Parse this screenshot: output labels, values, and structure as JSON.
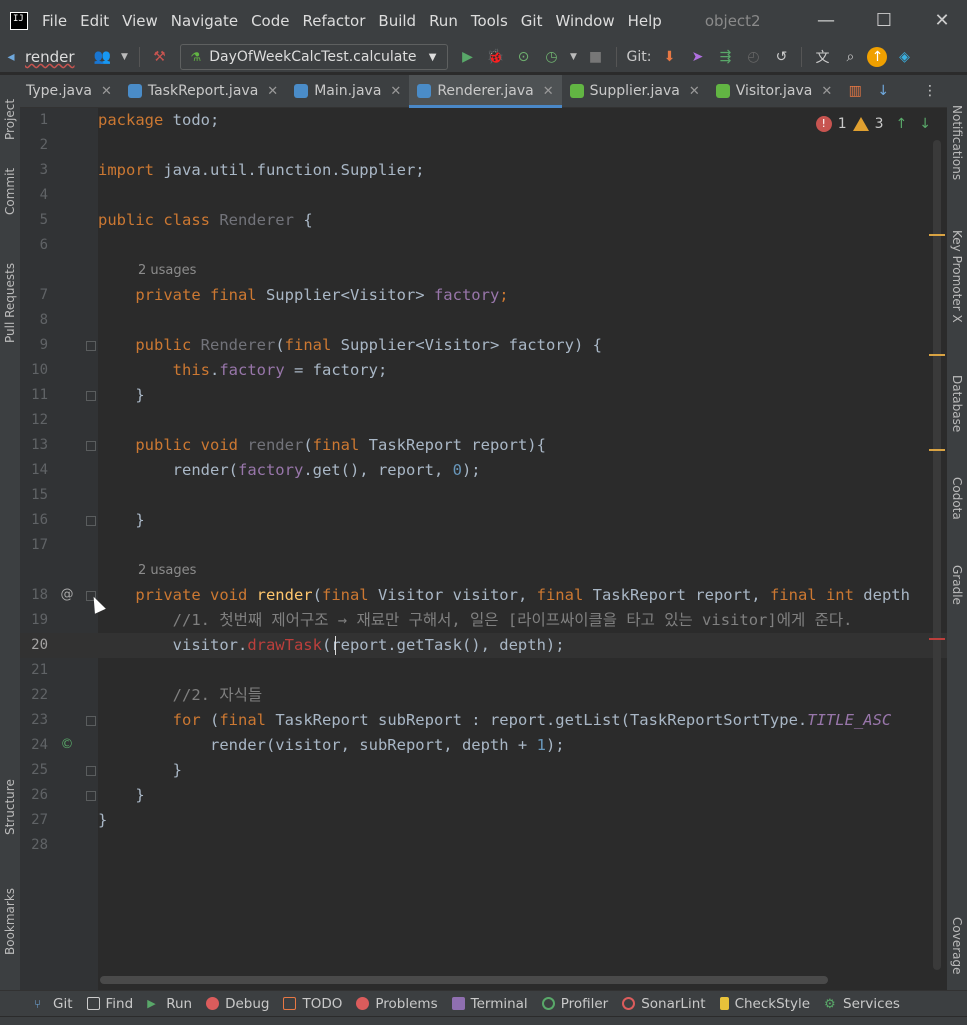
{
  "menu": {
    "items": [
      "File",
      "Edit",
      "View",
      "Navigate",
      "Code",
      "Refactor",
      "Build",
      "Run",
      "Tools",
      "Git",
      "Window",
      "Help"
    ],
    "project": "object2"
  },
  "toolbar": {
    "breadcrumb": "render",
    "run_config": "DayOfWeekCalcTest.calculate",
    "git_label": "Git:"
  },
  "left_stripe": [
    "Project",
    "Commit",
    "Pull Requests",
    "Structure",
    "Bookmarks"
  ],
  "right_stripe": [
    "Notifications",
    "Key Promoter X",
    "Database",
    "Codota",
    "Gradle",
    "Coverage"
  ],
  "tabs": [
    {
      "label": "Type.java",
      "color": "#4a8cc8",
      "active": false
    },
    {
      "label": "TaskReport.java",
      "color": "#4a8cc8",
      "active": false
    },
    {
      "label": "Main.java",
      "color": "#4a8cc8",
      "active": false
    },
    {
      "label": "Renderer.java",
      "color": "#4a8cc8",
      "active": true
    },
    {
      "label": "Supplier.java",
      "color": "#62b543",
      "active": false
    },
    {
      "label": "Visitor.java",
      "color": "#62b543",
      "active": false
    }
  ],
  "inspections": {
    "errors": "1",
    "warnings": "3"
  },
  "editor": {
    "usages_hint": "2 usages",
    "lines": [
      {
        "n": "1"
      },
      {
        "n": "2"
      },
      {
        "n": "3"
      },
      {
        "n": "4"
      },
      {
        "n": "5"
      },
      {
        "n": "6"
      },
      {
        "n": "7"
      },
      {
        "n": "8"
      },
      {
        "n": "9"
      },
      {
        "n": "10"
      },
      {
        "n": "11"
      },
      {
        "n": "12"
      },
      {
        "n": "13"
      },
      {
        "n": "14"
      },
      {
        "n": "15"
      },
      {
        "n": "16"
      },
      {
        "n": "17"
      },
      {
        "n": "18"
      },
      {
        "n": "19"
      },
      {
        "n": "20"
      },
      {
        "n": "21"
      },
      {
        "n": "22"
      },
      {
        "n": "23"
      },
      {
        "n": "24"
      },
      {
        "n": "25"
      },
      {
        "n": "26"
      },
      {
        "n": "27"
      },
      {
        "n": "28"
      }
    ],
    "code": {
      "l1a": "package",
      "l1b": " todo;",
      "l3a": "import",
      "l3b": " java.util.function.Supplier;",
      "l5a": "public class",
      "l5b": " Renderer",
      "l5c": " {",
      "l7a": "    private final",
      "l7b": " Supplier<Visitor> ",
      "l7c": "factory",
      "l7d": ";",
      "l9a": "    public",
      "l9b": " Renderer",
      "l9c": "(",
      "l9d": "final",
      "l9e": " Supplier<Visitor> factory) {",
      "l10a": "        this",
      "l10b": ".",
      "l10c": "factory",
      "l10d": " = factory;",
      "l11": "    }",
      "l13a": "    public void",
      "l13b": " render",
      "l13c": "(",
      "l13d": "final",
      "l13e": " TaskReport report){",
      "l14a": "        render(",
      "l14b": "factory",
      "l14c": ".get(), report, ",
      "l14d": "0",
      "l14e": ");",
      "l16": "    }",
      "l18a": "    private void",
      "l18b": " render",
      "l18c": "(",
      "l18d": "final",
      "l18e": " Visitor visitor, ",
      "l18f": "final",
      "l18g": " TaskReport report, ",
      "l18h": "final int",
      "l18i": " depth",
      "l19": "        //1. 첫번째 제어구조 → 재료만 구해서, 일은 [라이프싸이클을 타고 있는 visitor]에게 준다.",
      "l20a": "        visitor.",
      "l20b": "drawTask",
      "l20c": "(report.getTask(), depth);",
      "l22": "        //2. 자식들",
      "l23a": "        for",
      "l23b": " (",
      "l23c": "final",
      "l23d": " TaskReport subReport : report.getList(TaskReportSortType.",
      "l23e": "TITLE_ASC",
      "l24a": "            render(visitor, subReport, depth + ",
      "l24b": "1",
      "l24c": ");",
      "l25": "        }",
      "l26": "    }",
      "l27": "}"
    }
  },
  "bottom_tools": [
    "Git",
    "Find",
    "Run",
    "Debug",
    "TODO",
    "Problems",
    "Terminal",
    "Profiler",
    "SonarLint",
    "CheckStyle",
    "Services"
  ]
}
